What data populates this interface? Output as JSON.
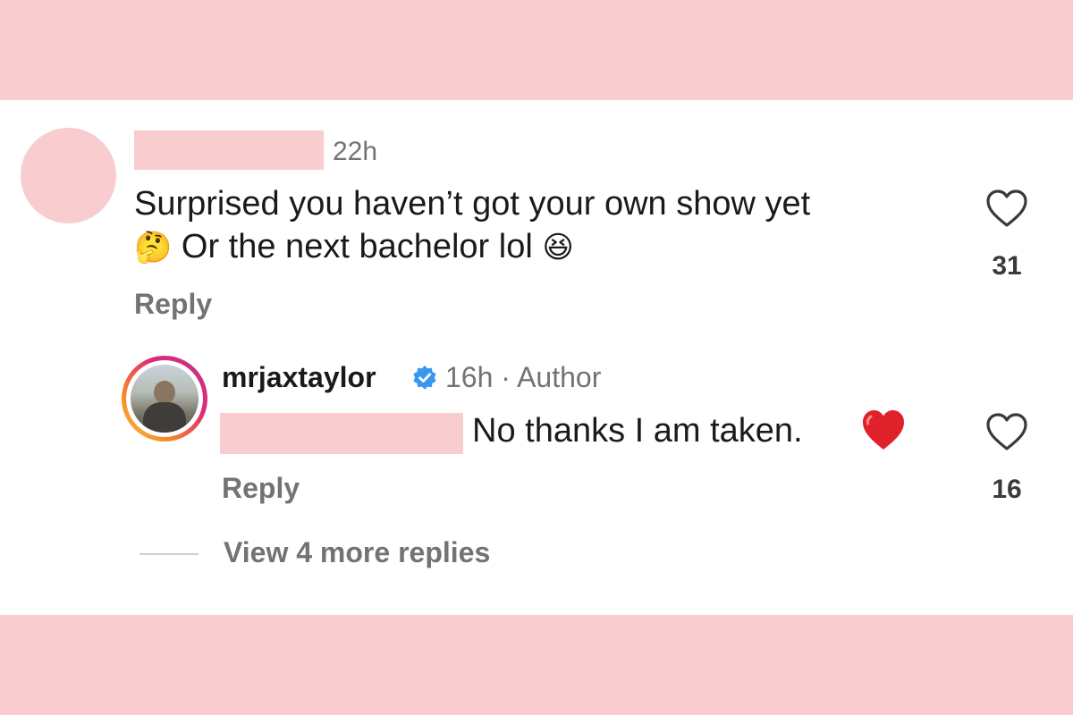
{
  "comment": {
    "timestamp": "22h",
    "text_line1": "Surprised you haven’t got your own show yet",
    "text_line2": "Or the next bachelor lol",
    "emoji_thinking": "🤔",
    "emoji_laughing": "😆",
    "reply_label": "Reply",
    "like_count": "31"
  },
  "reply": {
    "author": "mrjaxtaylor",
    "meta": "16h · Author",
    "text": "No thanks I am taken.",
    "reply_label": "Reply",
    "like_count": "16"
  },
  "view_more_label": "View 4 more replies",
  "colors": {
    "background_pink": "#f9cdd0",
    "panel": "#ffffff",
    "text_primary": "#1a1a1a",
    "text_secondary": "#737373",
    "verified_blue": "#3897f0",
    "heart_red": "#e0202a"
  }
}
